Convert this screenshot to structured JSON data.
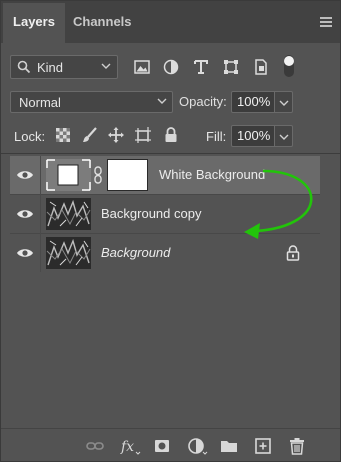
{
  "tabs": [
    {
      "label": "Layers",
      "active": true
    },
    {
      "label": "Channels",
      "active": false
    }
  ],
  "filter": {
    "kind_label": "Kind",
    "icons": [
      "image-filter-icon",
      "adjustment-filter-icon",
      "type-filter-icon",
      "shape-filter-icon",
      "smart-object-filter-icon",
      "filter-toggle-icon"
    ]
  },
  "blend": {
    "mode": "Normal",
    "opacity_label": "Opacity:",
    "opacity_value": "100%"
  },
  "lock": {
    "label": "Lock:",
    "icons": [
      "lock-transparent-pixels-icon",
      "lock-image-pixels-icon",
      "lock-position-icon",
      "lock-artboard-icon",
      "lock-all-icon"
    ],
    "fill_label": "Fill:",
    "fill_value": "100%"
  },
  "layers": [
    {
      "name": "White Background",
      "selected": true,
      "has_mask": true,
      "italic": false,
      "locked": false
    },
    {
      "name": "Background copy",
      "selected": false,
      "has_mask": false,
      "italic": false,
      "locked": false
    },
    {
      "name": "Background",
      "selected": false,
      "has_mask": false,
      "italic": true,
      "locked": true
    }
  ],
  "annotation": {
    "arrow_color": "#22c40a"
  },
  "footer": {
    "icons": [
      "link-layers-icon",
      "fx-icon",
      "add-mask-icon",
      "adjustment-layer-icon",
      "group-folder-icon",
      "new-layer-icon",
      "trash-icon"
    ]
  },
  "colors": {
    "panel_bg": "#535353",
    "tab_bar_bg": "#424242",
    "selected_row": "#6a6a6a",
    "text": "#e6e6e6"
  }
}
